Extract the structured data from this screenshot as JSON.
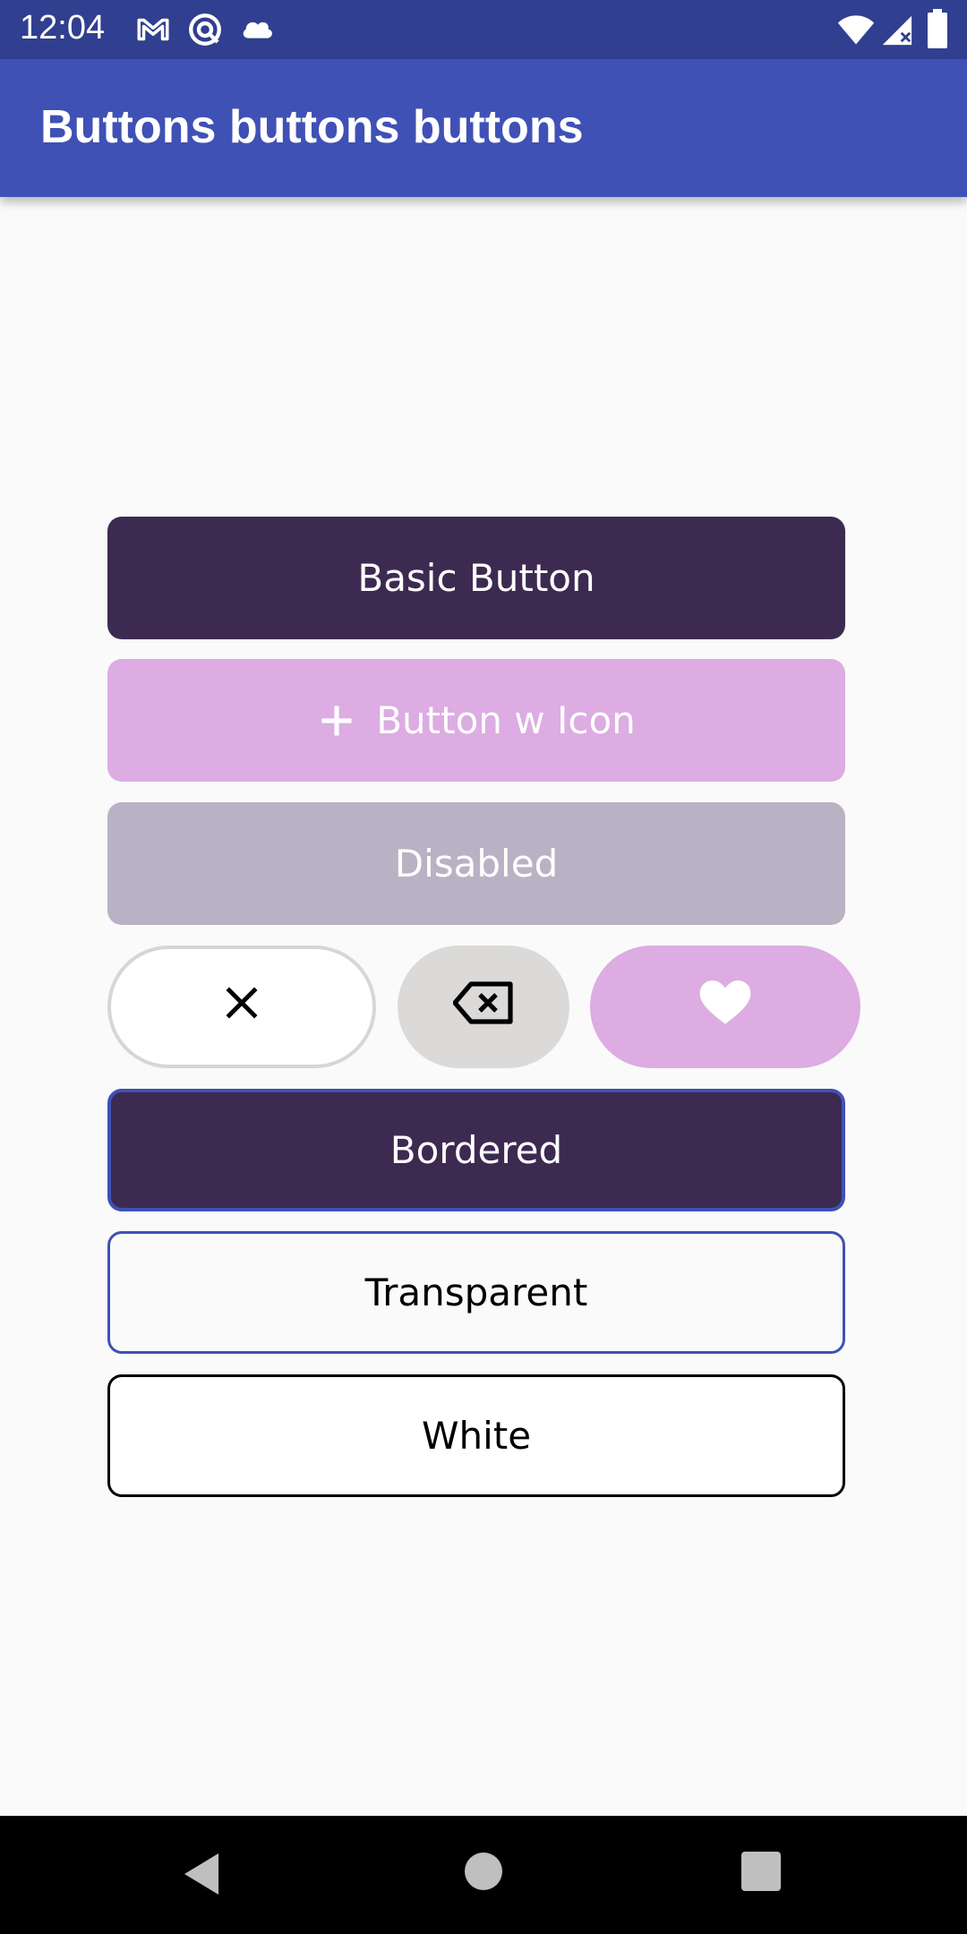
{
  "status_bar": {
    "time": "12:04",
    "left_icons": [
      "gmail-icon",
      "sync-icon",
      "cloud-icon"
    ],
    "right_icons": [
      "wifi-icon",
      "signal-icon",
      "battery-icon"
    ]
  },
  "app_bar": {
    "title": "Buttons buttons buttons",
    "color": "#3f51b5"
  },
  "buttons": {
    "basic": "Basic Button",
    "with_icon": "Button w Icon",
    "with_icon_icon": "plus-icon",
    "disabled": "Disabled",
    "round_close_icon": "close-icon",
    "round_backspace_icon": "backspace-icon",
    "round_heart_icon": "heart-icon",
    "bordered": "Bordered",
    "transparent": "Transparent",
    "white": "White"
  },
  "colors": {
    "primary_dark": "#3d2a51",
    "accent_pink": "#dcace3",
    "disabled_gray": "#b9b2c4",
    "border_blue": "#3f51b5"
  },
  "nav_bar": {
    "icons": [
      "back-icon",
      "home-icon",
      "recents-icon"
    ]
  }
}
